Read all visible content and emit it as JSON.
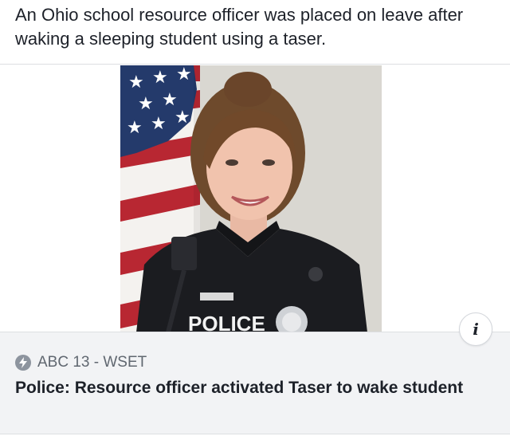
{
  "post": {
    "text": "An Ohio school resource officer was placed on leave after waking a sleeping student using a taser."
  },
  "link_preview": {
    "photo_alt": "Portrait of a smiling police officer in uniform in front of an American flag",
    "badge_text": "POLICE",
    "info_icon": "info-icon",
    "source_icon": "lightning-icon",
    "source": "ABC 13 - WSET",
    "headline": "Police: Resource officer activated Taser to wake student"
  },
  "colors": {
    "caption_bg": "#f2f3f5",
    "text_primary": "#1d2129",
    "text_secondary": "#606770",
    "divider": "#dddfe2"
  }
}
